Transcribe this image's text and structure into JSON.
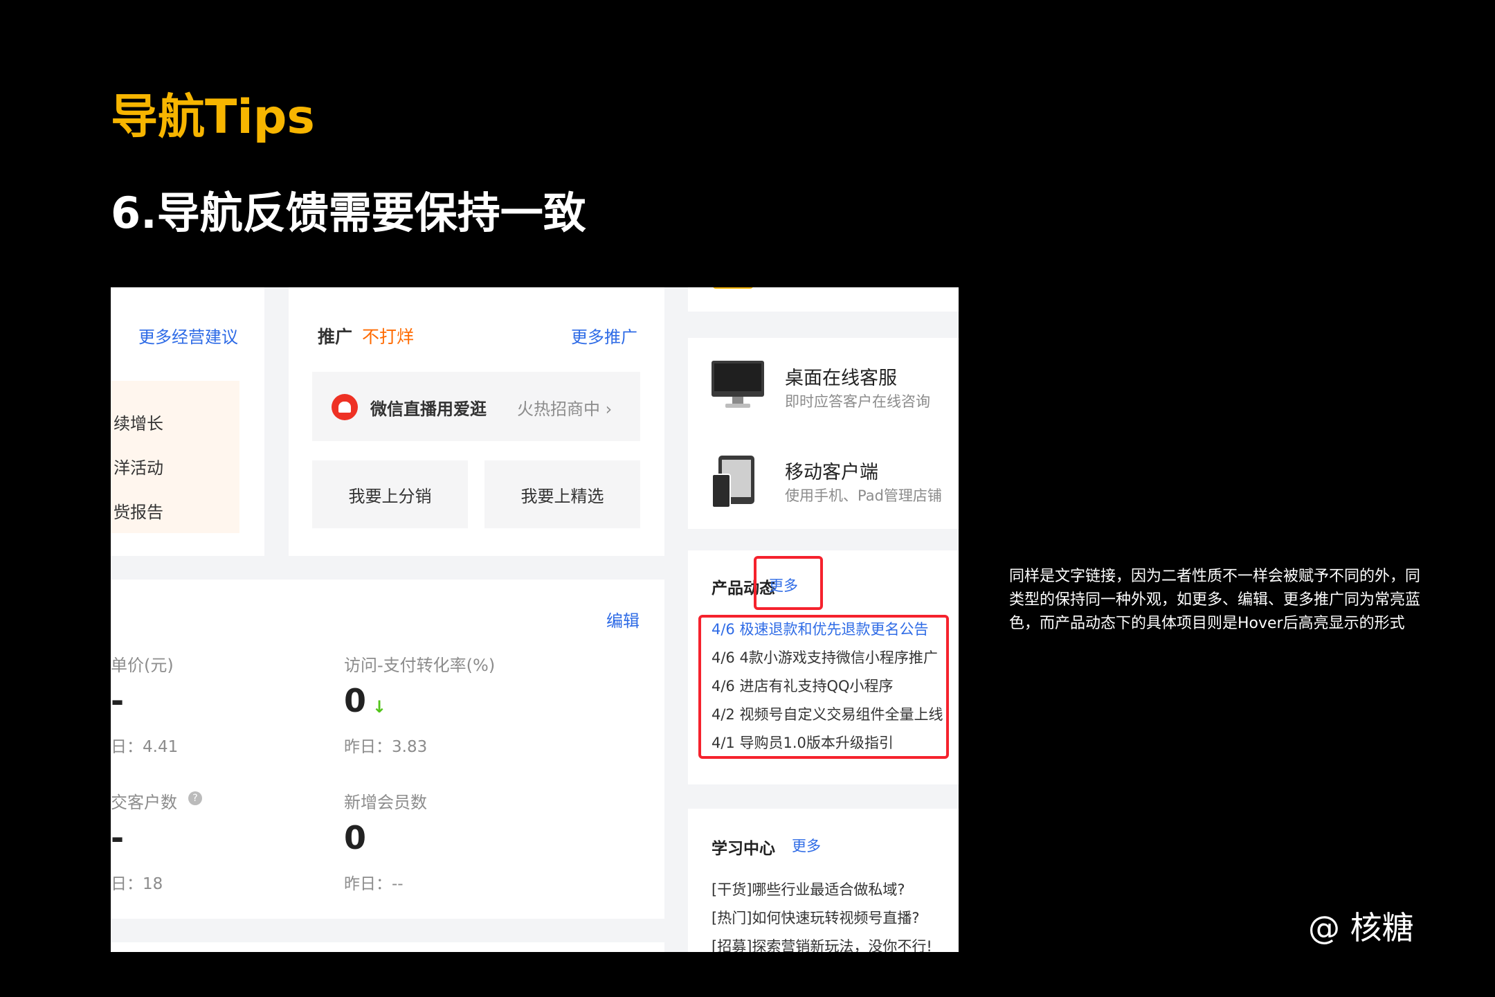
{
  "slide": {
    "tag": "导航Tips",
    "title": "6.导航反馈需要保持一致",
    "description": "同样是文字链接，因为二者性质不一样会被赋予不同的外，同类型的保持同一种外观，如更多、编辑、更多推广同为常亮蓝色，而产品动态下的具体项目则是Hover后高亮显示的形式",
    "credit": "@ 核糖"
  },
  "advice_card": {
    "more_link": "更多经营建议",
    "items": [
      "续增长",
      "洋活动",
      "赀报告"
    ]
  },
  "promo_card": {
    "title": "推广",
    "title_accent": "不打烊",
    "more_link": "更多推广",
    "banner_label": "微信直播用爱逛",
    "banner_status": "火热招商中 ›",
    "buttons": [
      "我要上分销",
      "我要上精选"
    ]
  },
  "stats_card": {
    "edit_link": "编辑",
    "stats": [
      {
        "label": "单价(元)",
        "value": "-",
        "prev": "日：4.41"
      },
      {
        "label": "访问-支付转化率(%)",
        "value": "0",
        "arrow": "↓",
        "prev": "昨日：3.83"
      },
      {
        "label": "交客户数",
        "value": "-",
        "prev": "日：18"
      },
      {
        "label": "新增会员数",
        "value": "0",
        "prev": "昨日：--"
      }
    ]
  },
  "service_card": {
    "items": [
      {
        "title": "桌面在线客服",
        "subtitle": "即时应答客户在线咨询"
      },
      {
        "title": "移动客户端",
        "subtitle": "使用手机、Pad管理店铺"
      }
    ]
  },
  "news_card": {
    "title": "产品动态",
    "more_link": "更多",
    "items": [
      "4/6 极速退款和优先退款更名公告",
      "4/6 4款小游戏支持微信小程序推广",
      "4/6 进店有礼支持QQ小程序",
      "4/2 视频号自定义交易组件全量上线",
      "4/1 导购员1.0版本升级指引"
    ]
  },
  "learn_card": {
    "title": "学习中心",
    "more_link": "更多",
    "items": [
      "[干货]哪些行业最适合做私域?",
      "[热门]如何快速玩转视频号直播?",
      "[招募]探索营销新玩法，没你不行!"
    ]
  },
  "colors": {
    "accent": "#f7b500",
    "link_blue": "#2e6be6",
    "highlight_red": "#f5222d",
    "promo_orange": "#ff6a00"
  }
}
